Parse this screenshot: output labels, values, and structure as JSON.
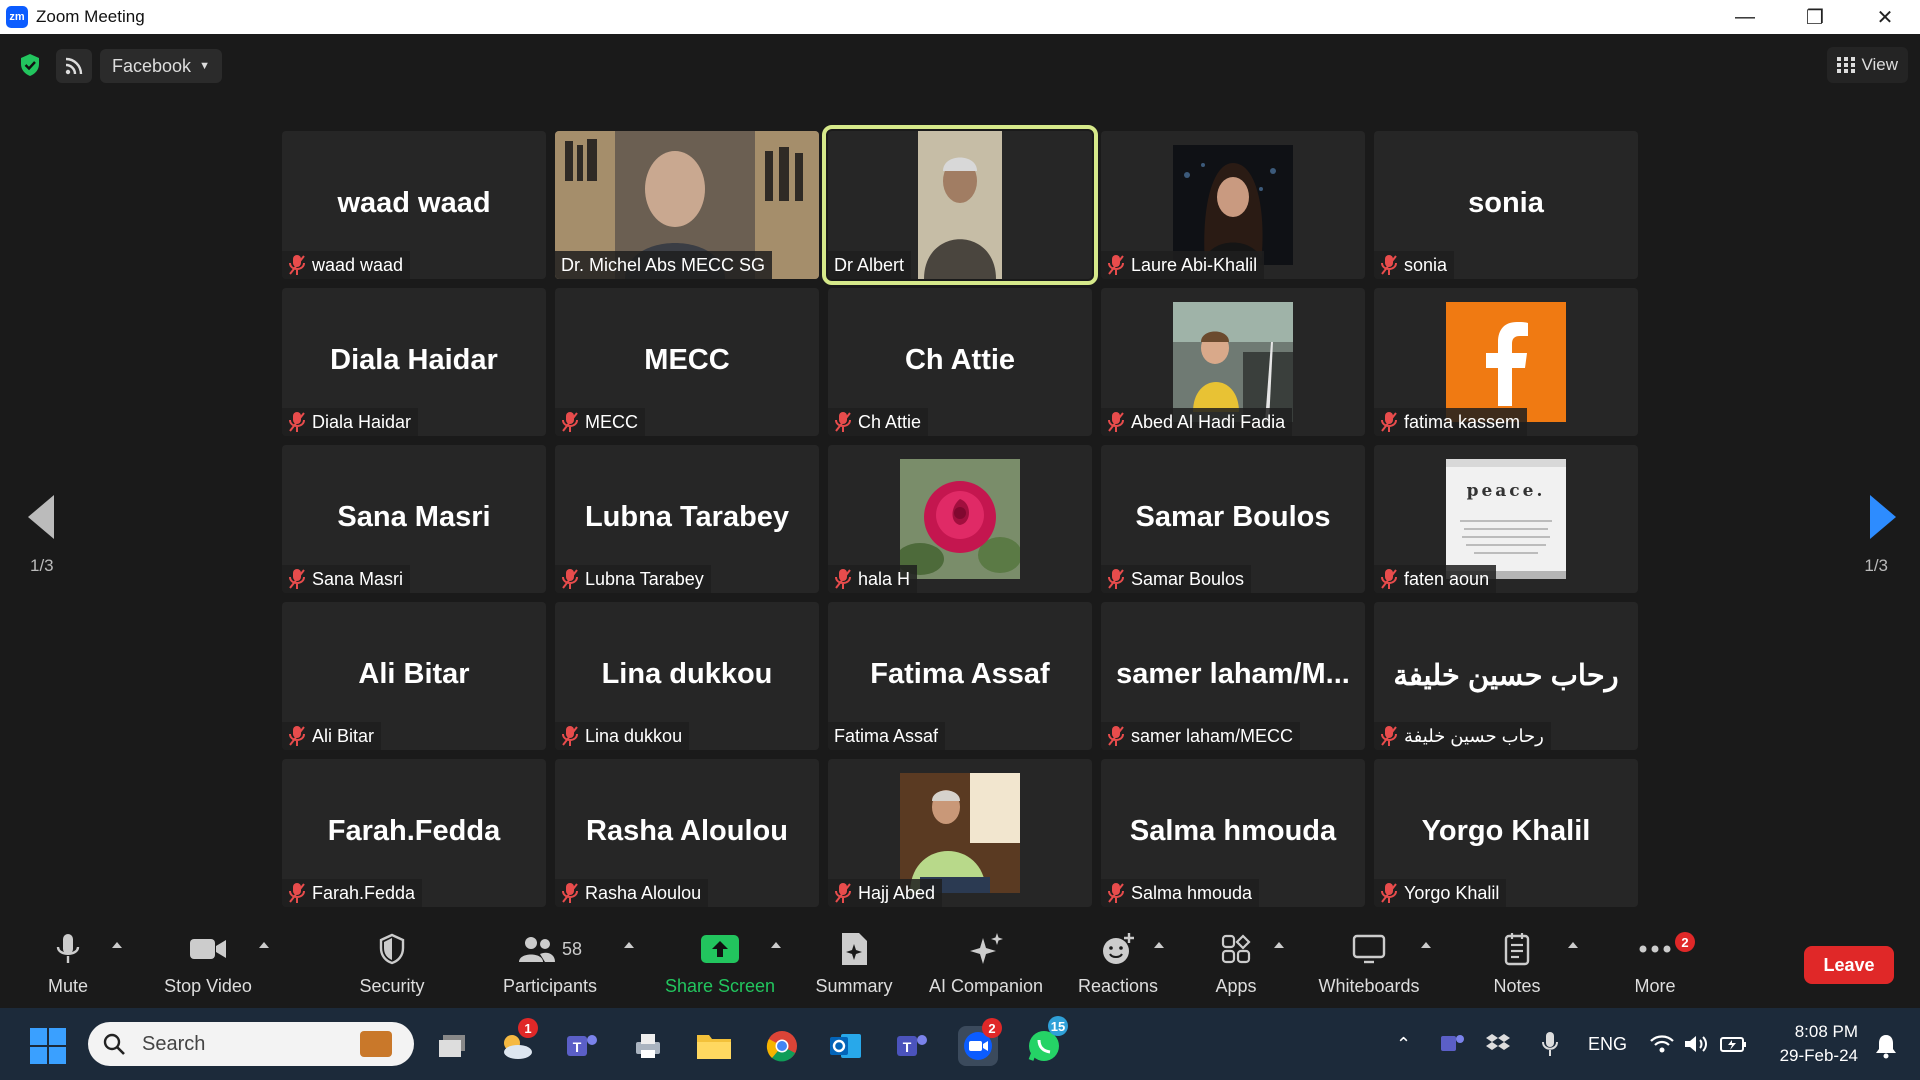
{
  "window": {
    "title": "Zoom Meeting",
    "logo_text": "zm"
  },
  "topbar": {
    "livestream_label": "Facebook",
    "view_label": "View"
  },
  "pagination": {
    "left": "1/3",
    "right": "1/3"
  },
  "tiles": [
    {
      "big": "waad waad",
      "label": "waad waad",
      "muted": true,
      "kind": "name"
    },
    {
      "big": "",
      "label": "Dr. Michel Abs MECC SG",
      "muted": false,
      "kind": "video-office"
    },
    {
      "big": "",
      "label": "Dr Albert",
      "muted": false,
      "kind": "video-man",
      "active": true
    },
    {
      "big": "",
      "label": "Laure Abi-Khalil",
      "muted": true,
      "kind": "photo-woman"
    },
    {
      "big": "sonia",
      "label": "sonia",
      "muted": true,
      "kind": "name"
    },
    {
      "big": "Diala Haidar",
      "label": "Diala Haidar",
      "muted": true,
      "kind": "name"
    },
    {
      "big": "MECC",
      "label": "MECC",
      "muted": true,
      "kind": "name"
    },
    {
      "big": "Ch Attie",
      "label": "Ch Attie",
      "muted": true,
      "kind": "name"
    },
    {
      "big": "",
      "label": "Abed Al Hadi Fadia",
      "muted": true,
      "kind": "photo-child"
    },
    {
      "big": "",
      "label": "fatima kassem",
      "muted": true,
      "kind": "photo-facebook"
    },
    {
      "big": "Sana Masri",
      "label": "Sana Masri",
      "muted": true,
      "kind": "name"
    },
    {
      "big": "Lubna Tarabey",
      "label": "Lubna Tarabey",
      "muted": true,
      "kind": "name"
    },
    {
      "big": "",
      "label": "hala H",
      "muted": true,
      "kind": "photo-rose"
    },
    {
      "big": "Samar Boulos",
      "label": "Samar Boulos",
      "muted": true,
      "kind": "name"
    },
    {
      "big": "",
      "label": "faten aoun",
      "muted": true,
      "kind": "photo-peace",
      "pic_text": "peace."
    },
    {
      "big": "Ali Bitar",
      "label": "Ali Bitar",
      "muted": true,
      "kind": "name"
    },
    {
      "big": "Lina dukkou",
      "label": "Lina dukkou",
      "muted": true,
      "kind": "name"
    },
    {
      "big": "Fatima Assaf",
      "label": "Fatima Assaf",
      "muted": false,
      "kind": "name"
    },
    {
      "big": "samer  laham/M...",
      "label": "samer laham/MECC",
      "muted": true,
      "kind": "name"
    },
    {
      "big": "رحاب حسين خليفة",
      "label": "رحاب حسين خليفة",
      "muted": true,
      "kind": "name"
    },
    {
      "big": "Farah.Fedda",
      "label": "Farah.Fedda",
      "muted": true,
      "kind": "name"
    },
    {
      "big": "Rasha Aloulou",
      "label": "Rasha Aloulou",
      "muted": true,
      "kind": "name"
    },
    {
      "big": "",
      "label": "Hajj Abed",
      "muted": true,
      "kind": "photo-man-green"
    },
    {
      "big": "Salma hmouda",
      "label": "Salma hmouda",
      "muted": true,
      "kind": "name"
    },
    {
      "big": "Yorgo Khalil",
      "label": "Yorgo Khalil",
      "muted": true,
      "kind": "name"
    }
  ],
  "toolbar": {
    "mute": "Mute",
    "stop_video": "Stop Video",
    "security": "Security",
    "participants": "Participants",
    "participants_count": "58",
    "share_screen": "Share Screen",
    "summary": "Summary",
    "ai_companion": "AI Companion",
    "reactions": "Reactions",
    "apps": "Apps",
    "whiteboards": "Whiteboards",
    "notes": "Notes",
    "more": "More",
    "more_badge": "2",
    "leave": "Leave"
  },
  "taskbar": {
    "search_placeholder": "Search",
    "weather_badge": "1",
    "zoom_badge": "2",
    "whatsapp_badge": "15",
    "lang": "ENG",
    "time": "8:08 PM",
    "date": "29-Feb-24"
  },
  "colors": {
    "accent_blue": "#2d8cff",
    "share_green": "#22c55e",
    "leave_red": "#e02828",
    "active_border": "#d6e98a",
    "mute_red": "#e84c4c"
  }
}
